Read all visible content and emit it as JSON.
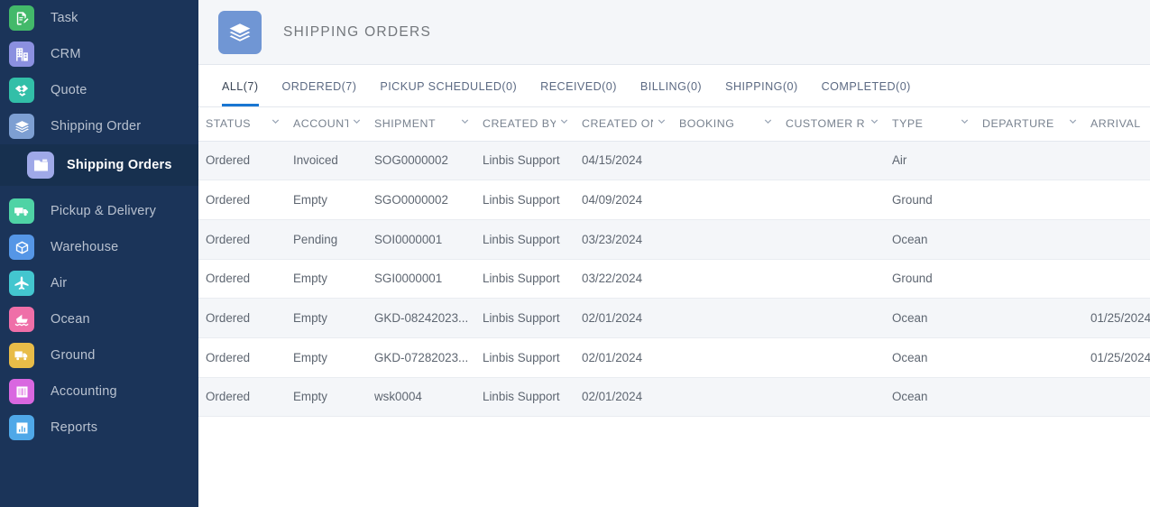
{
  "sidebar": {
    "items": [
      {
        "label": "Task",
        "icon": "task-icon",
        "color": "#43b96a"
      },
      {
        "label": "CRM",
        "icon": "building-icon",
        "color": "#8b90e0"
      },
      {
        "label": "Quote",
        "icon": "handshake-icon",
        "color": "#32bfa8"
      },
      {
        "label": "Shipping Order",
        "icon": "layers-icon",
        "color": "#7d9fd2"
      },
      {
        "label": "Pickup & Delivery",
        "icon": "truck-icon",
        "color": "#4fd3a5"
      },
      {
        "label": "Warehouse",
        "icon": "box-icon",
        "color": "#5596e6"
      },
      {
        "label": "Air",
        "icon": "airplane-icon",
        "color": "#43c6cf"
      },
      {
        "label": "Ocean",
        "icon": "ship-icon",
        "color": "#ef6fa8"
      },
      {
        "label": "Ground",
        "icon": "delivery-truck-icon",
        "color": "#e8bc48"
      },
      {
        "label": "Accounting",
        "icon": "book-icon",
        "color": "#d967e0"
      },
      {
        "label": "Reports",
        "icon": "bar-chart-icon",
        "color": "#4fa8e8"
      }
    ],
    "active_sub_item": {
      "label": "Shipping Orders",
      "icon": "folder-icon",
      "color": "#9fa9e8"
    }
  },
  "header": {
    "title": "SHIPPING ORDERS",
    "icon": "layers-icon",
    "icon_color": "#7096d4"
  },
  "tabs": [
    {
      "label": "ALL(7)",
      "active": true
    },
    {
      "label": "ORDERED(7)",
      "active": false
    },
    {
      "label": "PICKUP SCHEDULED(0)",
      "active": false
    },
    {
      "label": "RECEIVED(0)",
      "active": false
    },
    {
      "label": "BILLING(0)",
      "active": false
    },
    {
      "label": "SHIPPING(0)",
      "active": false
    },
    {
      "label": "COMPLETED(0)",
      "active": false
    }
  ],
  "table": {
    "columns": [
      {
        "label": "STATUS",
        "sortable": true
      },
      {
        "label": "ACCOUNT...",
        "sortable": true
      },
      {
        "label": "SHIPMENT",
        "sortable": true
      },
      {
        "label": "CREATED BY ...",
        "sortable": true
      },
      {
        "label": "CREATED ON ...",
        "sortable": true
      },
      {
        "label": "BOOKING",
        "sortable": true
      },
      {
        "label": "CUSTOMER RE...",
        "sortable": true
      },
      {
        "label": "TYPE",
        "sortable": true
      },
      {
        "label": "DEPARTURE",
        "sortable": true
      },
      {
        "label": "ARRIVAL",
        "sortable": false
      }
    ],
    "rows": [
      {
        "status": "Ordered",
        "account": "Invoiced",
        "shipment": "SOG0000002",
        "created_by": "Linbis Support",
        "created_on": "04/15/2024",
        "booking": "",
        "customer_ref": "",
        "type": "Air",
        "departure": "",
        "arrival": ""
      },
      {
        "status": "Ordered",
        "account": "Empty",
        "shipment": "SGO0000002",
        "created_by": "Linbis Support",
        "created_on": "04/09/2024",
        "booking": "",
        "customer_ref": "",
        "type": "Ground",
        "departure": "",
        "arrival": ""
      },
      {
        "status": "Ordered",
        "account": "Pending",
        "shipment": "SOI0000001",
        "created_by": "Linbis Support",
        "created_on": "03/23/2024",
        "booking": "",
        "customer_ref": "",
        "type": "Ocean",
        "departure": "",
        "arrival": ""
      },
      {
        "status": "Ordered",
        "account": "Empty",
        "shipment": "SGI0000001",
        "created_by": "Linbis Support",
        "created_on": "03/22/2024",
        "booking": "",
        "customer_ref": "",
        "type": "Ground",
        "departure": "",
        "arrival": ""
      },
      {
        "status": "Ordered",
        "account": "Empty",
        "shipment": "GKD-08242023...",
        "created_by": "Linbis Support",
        "created_on": "02/01/2024",
        "booking": "",
        "customer_ref": "",
        "type": "Ocean",
        "departure": "",
        "arrival": "01/25/2024"
      },
      {
        "status": "Ordered",
        "account": "Empty",
        "shipment": "GKD-07282023...",
        "created_by": "Linbis Support",
        "created_on": "02/01/2024",
        "booking": "",
        "customer_ref": "",
        "type": "Ocean",
        "departure": "",
        "arrival": "01/25/2024"
      },
      {
        "status": "Ordered",
        "account": "Empty",
        "shipment": "wsk0004",
        "created_by": "Linbis Support",
        "created_on": "02/01/2024",
        "booking": "",
        "customer_ref": "",
        "type": "Ocean",
        "departure": "",
        "arrival": ""
      }
    ]
  },
  "colors": {
    "sidebar_bg": "#1b3459",
    "sidebar_active_bg": "#17304f",
    "accent": "#1976d2",
    "link": "#4a86cc",
    "row_alt": "#f4f6f9",
    "header_bg": "#f4f6f9"
  }
}
